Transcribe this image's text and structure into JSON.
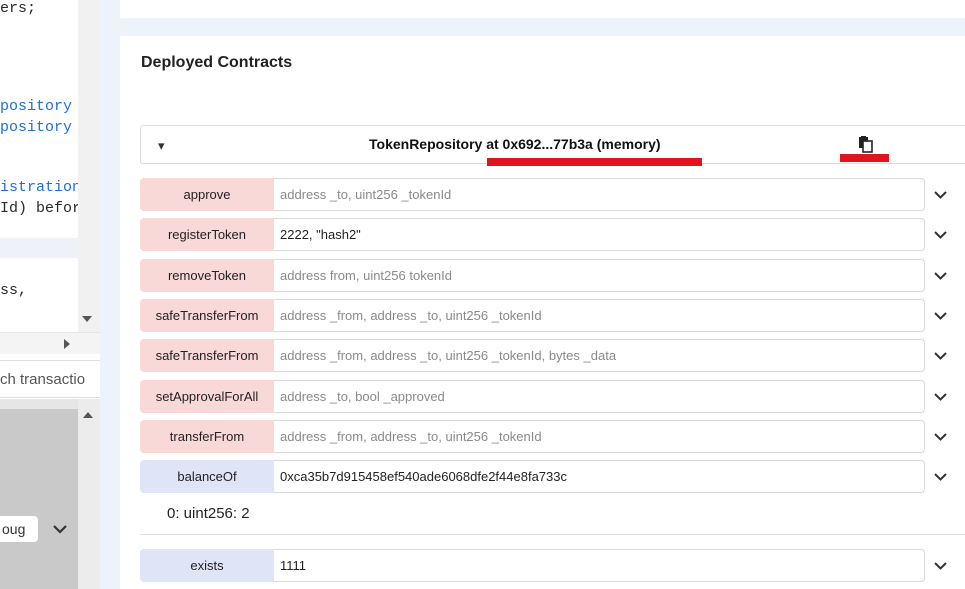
{
  "editor": {
    "code_lines": [
      {
        "text": "ers;",
        "style": "dark"
      },
      {
        "text": "pository",
        "style": "blue"
      },
      {
        "text": "pository",
        "style": "blue"
      },
      {
        "text": "istration",
        "style": "blue"
      },
      {
        "text": "Id) befor",
        "style": "dark"
      },
      {
        "text": "ss,",
        "style": "dark"
      }
    ],
    "search_text": "ch transactio",
    "debug_value": "oug"
  },
  "deployed": {
    "title": "Deployed Contracts",
    "contract_title": "TokenRepository at 0x692...77b3a (memory)",
    "functions": [
      {
        "label": "approve",
        "kind": "transact",
        "value": "",
        "placeholder": "address _to, uint256 _tokenId"
      },
      {
        "label": "registerToken",
        "kind": "transact",
        "value": "2222, \"hash2\"",
        "placeholder": ""
      },
      {
        "label": "removeToken",
        "kind": "transact",
        "value": "",
        "placeholder": "address from, uint256 tokenId"
      },
      {
        "label": "safeTransferFrom",
        "kind": "transact",
        "value": "",
        "placeholder": "address _from, address _to, uint256 _tokenId"
      },
      {
        "label": "safeTransferFrom",
        "kind": "transact",
        "value": "",
        "placeholder": "address _from, address _to, uint256 _tokenId, bytes _data"
      },
      {
        "label": "setApprovalForAll",
        "kind": "transact",
        "value": "",
        "placeholder": "address _to, bool _approved"
      },
      {
        "label": "transferFrom",
        "kind": "transact",
        "value": "",
        "placeholder": "address _from, address _to, uint256 _tokenId"
      },
      {
        "label": "balanceOf",
        "kind": "call",
        "value": "0xca35b7d915458ef540ade6068dfe2f44e8fa733c",
        "placeholder": ""
      }
    ],
    "balance_result": "0: uint256: 2",
    "exists": {
      "label": "exists",
      "kind": "call",
      "value": "1111",
      "placeholder": ""
    }
  },
  "colors": {
    "transact_button": "#f9d8d8",
    "call_button": "#dfe4f6",
    "highlight_mark": "#e0141e",
    "code_keyword": "#1e6fd6"
  }
}
